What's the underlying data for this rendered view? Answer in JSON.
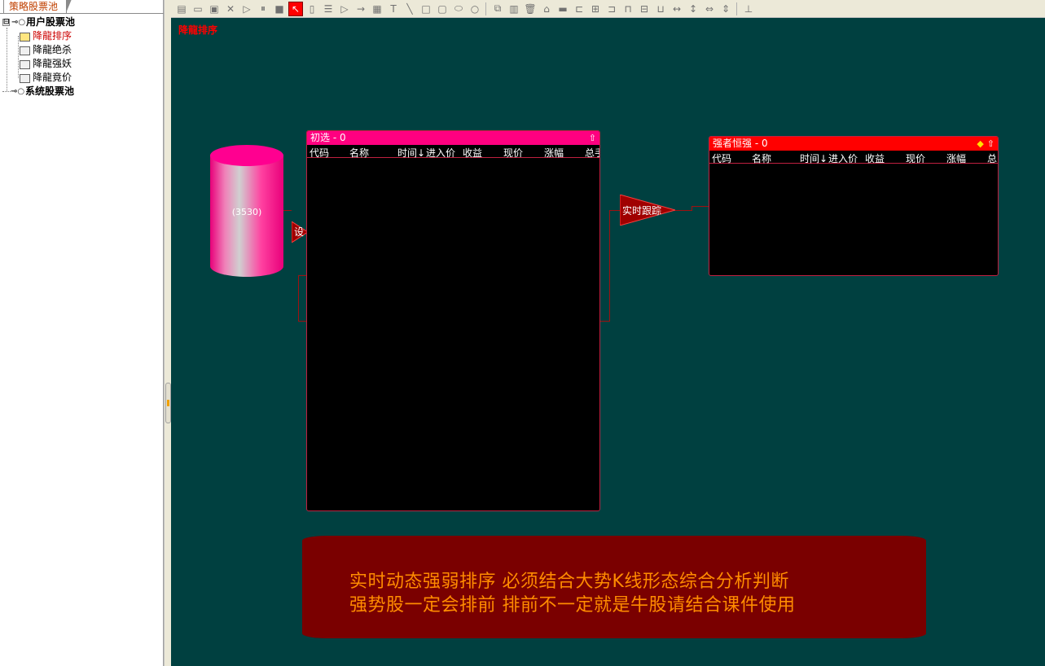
{
  "left_panel": {
    "tab_label": "策略股票池",
    "tree": {
      "user_pool": {
        "toggle": "⊟",
        "label": "用户股票池",
        "children": [
          {
            "label": "降龍排序"
          },
          {
            "label": "降龍绝杀"
          },
          {
            "label": "降龍强妖"
          },
          {
            "label": "降龍竟价"
          }
        ]
      },
      "system_pool": {
        "label": "系统股票池"
      }
    }
  },
  "canvas": {
    "title": "降龍排序",
    "source": {
      "label": "(3530)"
    },
    "filter_node": {
      "label": "设"
    },
    "track_node": {
      "label": "实时跟踪"
    },
    "panel_initial": {
      "title": "初选 - 0",
      "columns": [
        "代码",
        "名称",
        "时间↓",
        "进入价",
        "收益",
        "现价",
        "涨幅",
        "总手"
      ]
    },
    "panel_strong": {
      "title": "强者恒强  - 0",
      "columns": [
        "代码",
        "名称",
        "时间↓",
        "进入价",
        "收益",
        "现价",
        "涨幅",
        "总"
      ]
    },
    "banner": {
      "line1": "实时动态强弱排序  必须结合大势K线形态综合分析判断",
      "line2": "强势股一定会排前  排前不一定就是牛股请结合课件使用"
    }
  },
  "colors": {
    "canvas_bg": "#004040",
    "panel_initial_header": "#ff0080",
    "panel_strong_header": "#ff0000",
    "banner_bg": "#7a0000",
    "banner_text": "#ff8c00"
  }
}
